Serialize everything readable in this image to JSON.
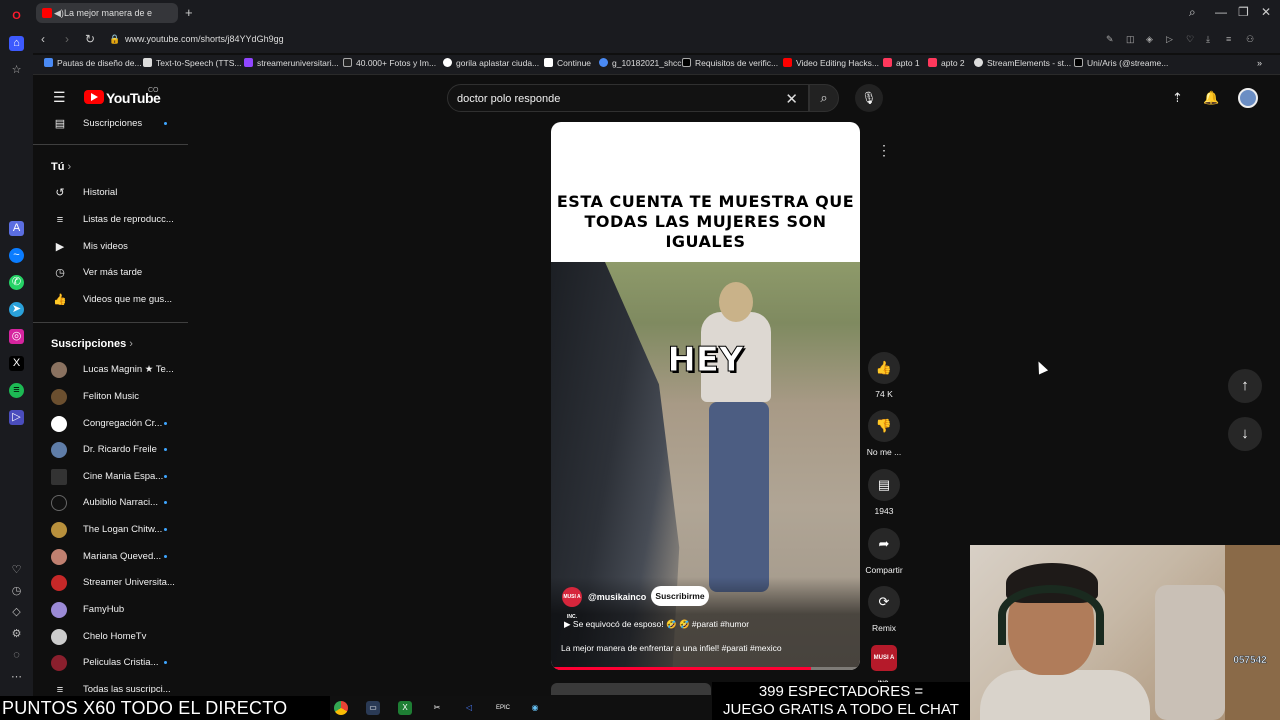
{
  "browser": {
    "tab_title": "La mejor manera de e",
    "url": "www.youtube.com/shorts/j84YYdGh9gg",
    "bookmarks": [
      "Pautas de diseño de...",
      "Text-to-Speech (TTS...",
      "streameruniversitari...",
      "40.000+ Fotos y Im...",
      "gorila aplastar ciuda...",
      "Continue",
      "g_10182021_shcc",
      "Requisitos de verific...",
      "Video Editing Hacks...",
      "apto 1",
      "apto 2",
      "StreamElements - st...",
      "Uni/Aris (@streame..."
    ]
  },
  "header": {
    "logo_text": "YouTube",
    "country": "CO",
    "search_value": "doctor polo responde"
  },
  "sidebar": {
    "top_item": "Suscripciones",
    "you_heading": "Tú",
    "you_items": [
      "Historial",
      "Listas de reproducc...",
      "Mis videos",
      "Ver más tarde",
      "Videos que me gus..."
    ],
    "subs_heading": "Suscripciones",
    "subscriptions": [
      "Lucas Magnin ★ Te...",
      "Feliton Music",
      "Congregación Cr...",
      "Dr. Ricardo Freile",
      "Cine Mania Espa...",
      "Aubiblio Narraci...",
      "The Logan Chitw...",
      "Mariana Queved...",
      "Streamer Universita...",
      "FamyHub",
      "Chelo HomeTv",
      "Peliculas Cristia...",
      "Todas las suscripci..."
    ]
  },
  "short": {
    "caption": "ESTA CUENTA TE MUESTRA QUE TODAS LAS MUJERES SON IGUALES",
    "overlay_text": "HEY",
    "channel": "@musikainco",
    "channel_avatar_text": "MUSI A INC.",
    "subscribe": "Suscribirme",
    "music": "Se equivocó de esposo! 🤣 🤣 #parati #humor",
    "title": "La mejor manera de enfrentar a una infiel! #parati #mexico",
    "progress": 0.84
  },
  "actions": {
    "likes": "74 K",
    "dislike": "No me ...",
    "comments": "1943",
    "share": "Compartir",
    "remix": "Remix",
    "sound_thumb_text": "MUSI A INC."
  },
  "stream": {
    "ticker": "PUNTOS X60 TODO EL DIRECTO",
    "viewers_line1": "399 ESPECTADORES =",
    "viewers_line2": "JUEGO GRATIS A TODO EL CHAT",
    "badge": "057542"
  },
  "colors": {
    "yt_red": "#ff0000",
    "progress": "#ff0033",
    "bg": "#0f0f0f"
  }
}
